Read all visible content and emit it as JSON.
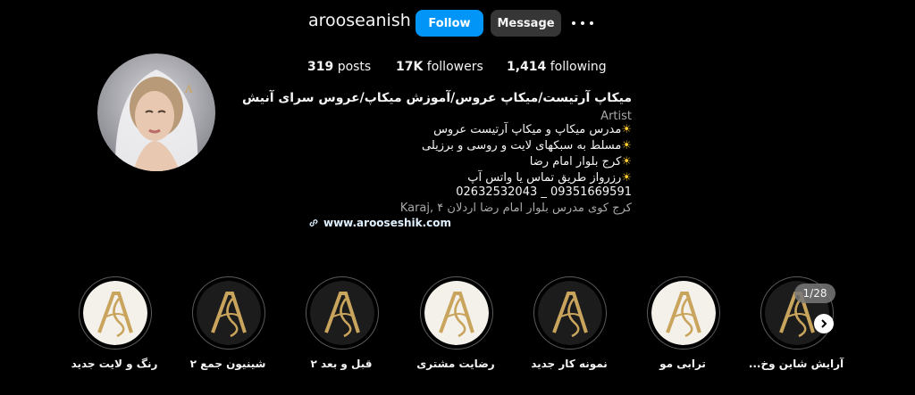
{
  "profile": {
    "username": "arooseanish",
    "follow_label": "Follow",
    "message_label": "Message",
    "stats": {
      "posts_count": "319",
      "posts_label": "posts",
      "followers_count": "17K",
      "followers_label": "followers",
      "following_count": "1,414",
      "following_label": "following"
    }
  },
  "bio": {
    "full_name": "میکاپ آرتیست/میکاپ عروس/آموزش میکاپ/عروس سرای آنیش",
    "category": "Artist",
    "lines": [
      "مدرس میکاپ و میکاپ آرتیست عروس",
      "مسلط به سبکهای لایت و روسی و برزیلی",
      "کرج بلوار امام رضا",
      "رزرواز طریق تماس یا واتس آپ"
    ],
    "phones": "02632532043 _ 09351669591",
    "address": "کرج کوی مدرس بلوار امام رضا اردلان ۴ ,Karaj",
    "website": "www.arooseshik.com"
  },
  "highlights": {
    "counter": "1/28",
    "items": [
      {
        "label": "رنگ و لایت جدید",
        "style": "light"
      },
      {
        "label": "شینیون جمع ۲",
        "style": "dark"
      },
      {
        "label": "قبل و بعد ۲",
        "style": "dark"
      },
      {
        "label": "رضایت مشتری",
        "style": "light"
      },
      {
        "label": "نمونه کار جدید",
        "style": "dark"
      },
      {
        "label": "ترابی مو",
        "style": "light"
      },
      {
        "label": "آرایش شاین وخ...",
        "style": "dark"
      }
    ]
  },
  "colors": {
    "follow_button": "#0095f6",
    "message_button": "#363636",
    "background": "#000000",
    "gold": "#c9a45c"
  }
}
